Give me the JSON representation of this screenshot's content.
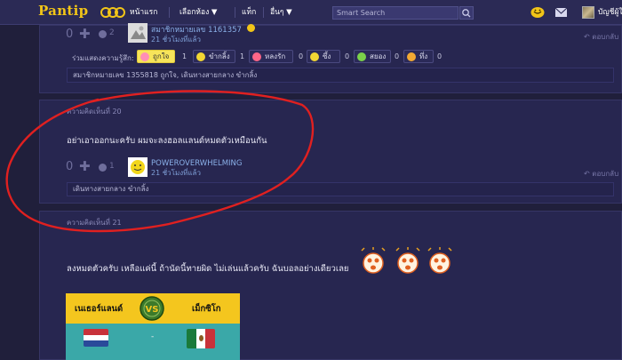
{
  "topbar": {
    "logo": "Pantip",
    "nav": [
      "หน้าแรก",
      "เลือกห้อง ▼",
      "แท็ก",
      "อื่นๆ ▼"
    ],
    "search_placeholder": "Smart Search",
    "user_name": "บัญชีผู้ใช้"
  },
  "comments": [
    {
      "votes": "0",
      "emotion_count": "2",
      "user_name": "สมาชิกหมายเลข 1161357",
      "time": "21 ชั่วโมงที่แล้ว",
      "reply": "ตอบกลับ",
      "react_label": "ร่วมแสดงความรู้สึก:",
      "reactions": [
        {
          "label": "ถูกใจ",
          "count": "1",
          "color": "#ff8fb5"
        },
        {
          "label": "ขำกลิ้ง",
          "count": "1",
          "color": "#f2d633"
        },
        {
          "label": "หลงรัก",
          "count": "0",
          "color": "#ff6688"
        },
        {
          "label": "ซึ้ง",
          "count": "0",
          "color": "#f2d633"
        },
        {
          "label": "สยอง",
          "count": "0",
          "color": "#7bd14a"
        },
        {
          "label": "ทึ่ง",
          "count": "0",
          "color": "#f2a933"
        }
      ],
      "footer": "สมาชิกหมายเลข 1355818 ถูกใจ, เดินทางสายกลาง ขำกลิ้ง"
    },
    {
      "label": "ความคิดเห็นที่ 20",
      "text": "อย่าเอาออกนะครับ ผมจะลงฮอลแลนด์หมดตัวเหมือนกัน",
      "votes": "0",
      "emotion_count": "1",
      "user_name": "POWEROVERWHELMING",
      "time": "21 ชั่วโมงที่แล้ว",
      "reply": "ตอบกลับ",
      "footer": "เดินทางสายกลาง ขำกลิ้ง"
    },
    {
      "label": "ความคิดเห็นที่ 21",
      "text": "ลงหมดตัวครับ เหลือแค่นี้ ถ้านัดนี้ทายผิด ไม่เล่นแล้วครับ ฉันบอลอย่างเดียวเลย",
      "match": {
        "team_left": "เนเธอร์แลนด์",
        "team_right": "เม็กซิโก",
        "vs": "VS",
        "score": "-"
      }
    }
  ]
}
